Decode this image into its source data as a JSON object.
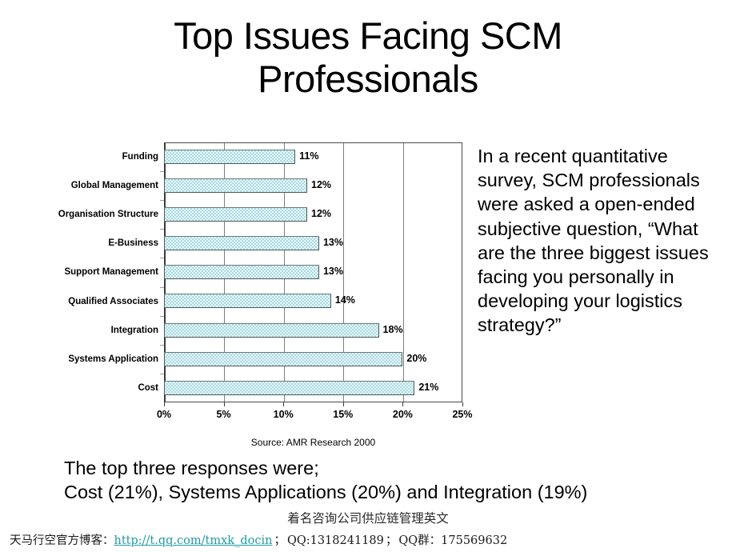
{
  "slide": {
    "title_line1": "Top Issues Facing SCM",
    "title_line2": "Professionals"
  },
  "narrative": {
    "text": "In a recent quantitative survey, SCM professionals were asked a open-ended subjective question, “What are the three biggest issues facing you personally in developing your logistics strategy?”"
  },
  "summary": {
    "line1": "The top three responses were;",
    "line2": "Cost (21%), Systems Applications (20%) and Integration (19%)"
  },
  "doc_title": "着名咨询公司供应链管理英文",
  "footer": {
    "blog_label": "天马行空官方博客：",
    "url": "http://t.qq.com/tmxk_docin",
    "sep1": "；",
    "qq": "QQ:1318241189",
    "sep2": "；",
    "qq_group_label": "QQ群：",
    "qq_group": "175569632"
  },
  "colors": {
    "bar_fill": "#a9dce3",
    "bar_border": "#4d5a5a",
    "gridline": "#808080",
    "axis": "#3b3b3b",
    "link": "#1f9ba6",
    "text": "#000000"
  },
  "chart_data": {
    "type": "bar",
    "orientation": "horizontal",
    "title": "",
    "xlabel": "",
    "ylabel": "",
    "source": "Source: AMR Research 2000",
    "xlim": [
      0,
      25
    ],
    "xticks": [
      0,
      5,
      10,
      15,
      20,
      25
    ],
    "xtick_labels": [
      "0%",
      "5%",
      "10%",
      "15%",
      "20%",
      "25%"
    ],
    "grid": true,
    "legend": false,
    "categories": [
      "Funding",
      "Global Management",
      "Organisation Structure",
      "E-Business",
      "Support Management",
      "Qualified Associates",
      "Integration",
      "Systems Application",
      "Cost"
    ],
    "values": [
      11,
      12,
      12,
      13,
      13,
      14,
      18,
      20,
      21
    ],
    "data_labels": [
      "11%",
      "12%",
      "12%",
      "13%",
      "13%",
      "14%",
      "18%",
      "20%",
      "21%"
    ]
  }
}
